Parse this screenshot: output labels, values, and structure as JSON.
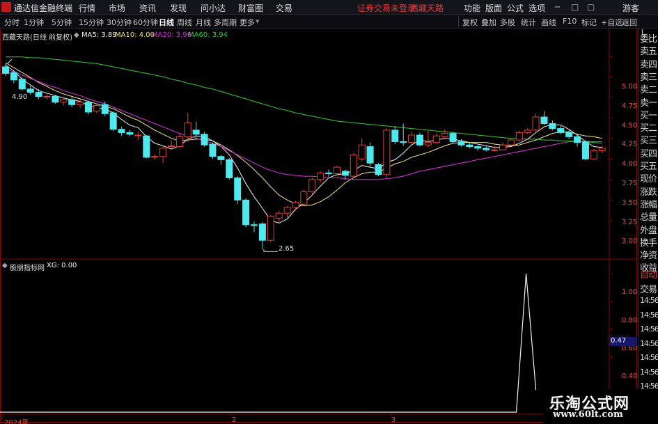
{
  "menubar": {
    "app_title": "通达信金融终端",
    "menus": [
      "行情",
      "市场",
      "资讯",
      "发现",
      "问小达",
      "财富圈",
      "交易"
    ],
    "trade_notice": "证券交易未登录",
    "stock_name": "西藏天路",
    "right_items": [
      "功能",
      "版面",
      "公式",
      "选项"
    ],
    "guest": "游客"
  },
  "toolbar": {
    "periods": [
      "分时",
      "1分钟",
      "5分钟",
      "15分钟",
      "30分钟",
      "60分钟",
      "日线",
      "周线",
      "月线",
      "多周期",
      "更多"
    ],
    "active_period": "日线",
    "tools": [
      "复权",
      "叠加",
      "多股",
      "统计",
      "画线",
      "F10",
      "标记",
      "+自选",
      "返回"
    ]
  },
  "main_panel": {
    "stock_label": "西藏天路(日线 前复权)",
    "ma_lines": [
      {
        "label": "MA5: 3.89",
        "color": "#f2f2f2"
      },
      {
        "label": "MA10: 4.00",
        "color": "#f0e68c"
      },
      {
        "label": "MA20: 3.96",
        "color": "#dd33dd"
      },
      {
        "label": "MA60: 3.94",
        "color": "#33cc33"
      }
    ],
    "y_labels": [
      "5.00",
      "4.75",
      "4.50",
      "4.25",
      "4.00",
      "3.75",
      "3.50",
      "3.25",
      "3.00"
    ],
    "y_range": [
      2.55,
      5.2
    ],
    "high_label": "4.90",
    "low_label": "2.65",
    "up_color": "#e0443a",
    "down_color": "#4ee8ee"
  },
  "candles": [
    [
      4.87,
      4.79,
      4.91,
      4.76
    ],
    [
      4.8,
      4.71,
      4.82,
      4.67
    ],
    [
      4.72,
      4.6,
      4.74,
      4.58
    ],
    [
      4.6,
      4.56,
      4.64,
      4.53
    ],
    [
      4.56,
      4.51,
      4.6,
      4.48
    ],
    [
      4.51,
      4.51,
      4.55,
      4.47
    ],
    [
      4.51,
      4.44,
      4.53,
      4.42
    ],
    [
      4.44,
      4.47,
      4.5,
      4.4
    ],
    [
      4.47,
      4.41,
      4.5,
      4.38
    ],
    [
      4.41,
      4.44,
      4.48,
      4.37
    ],
    [
      4.44,
      4.32,
      4.46,
      4.29
    ],
    [
      4.33,
      4.4,
      4.42,
      4.3
    ],
    [
      4.41,
      4.3,
      4.45,
      4.27
    ],
    [
      4.31,
      4.11,
      4.33,
      4.09
    ],
    [
      4.11,
      4.07,
      4.14,
      4.03
    ],
    [
      4.07,
      4.05,
      4.1,
      4.03
    ],
    [
      4.04,
      4.04,
      4.08,
      3.98
    ],
    [
      4.03,
      3.77,
      4.04,
      3.76
    ],
    [
      3.78,
      3.78,
      3.81,
      3.74
    ],
    [
      3.78,
      3.88,
      3.9,
      3.7
    ],
    [
      3.9,
      3.91,
      3.98,
      3.86
    ],
    [
      3.9,
      4.02,
      4.06,
      3.88
    ],
    [
      4.02,
      4.19,
      4.31,
      3.96
    ],
    [
      4.1,
      4.05,
      4.2,
      4.0
    ],
    [
      4.05,
      3.92,
      4.08,
      3.9
    ],
    [
      3.93,
      3.78,
      3.95,
      3.75
    ],
    [
      3.78,
      3.74,
      3.8,
      3.68
    ],
    [
      3.74,
      3.52,
      3.76,
      3.5
    ],
    [
      3.52,
      3.25,
      3.54,
      3.2
    ],
    [
      3.25,
      2.95,
      3.27,
      2.92
    ],
    [
      2.95,
      2.94,
      2.99,
      2.86
    ],
    [
      2.96,
      2.76,
      2.98,
      2.65
    ],
    [
      2.76,
      3.05,
      3.07,
      2.74
    ],
    [
      3.03,
      3.09,
      3.12,
      2.98
    ],
    [
      3.09,
      3.16,
      3.18,
      3.04
    ],
    [
      3.16,
      3.22,
      3.24,
      3.12
    ],
    [
      3.2,
      3.35,
      3.38,
      3.18
    ],
    [
      3.35,
      3.5,
      3.52,
      3.32
    ],
    [
      3.5,
      3.58,
      3.6,
      3.46
    ],
    [
      3.58,
      3.57,
      3.62,
      3.53
    ],
    [
      3.57,
      3.65,
      3.67,
      3.54
    ],
    [
      3.6,
      3.55,
      3.62,
      3.5
    ],
    [
      3.54,
      3.8,
      3.82,
      3.52
    ],
    [
      3.75,
      3.92,
      4.0,
      3.72
    ],
    [
      3.9,
      3.7,
      3.95,
      3.66
    ],
    [
      3.68,
      3.56,
      3.7,
      3.54
    ],
    [
      3.56,
      4.1,
      4.12,
      3.52
    ],
    [
      4.1,
      3.96,
      4.15,
      3.93
    ],
    [
      3.96,
      3.95,
      4.18,
      3.91
    ],
    [
      3.95,
      4.04,
      4.08,
      3.92
    ],
    [
      4.04,
      3.92,
      4.07,
      3.9
    ],
    [
      3.92,
      3.95,
      4.1,
      3.89
    ],
    [
      3.95,
      4.03,
      4.06,
      3.93
    ],
    [
      4.02,
      4.06,
      4.11,
      4.0
    ],
    [
      4.06,
      3.96,
      4.08,
      3.94
    ],
    [
      3.96,
      3.92,
      3.99,
      3.9
    ],
    [
      3.92,
      3.9,
      3.95,
      3.88
    ],
    [
      3.9,
      3.88,
      3.92,
      3.85
    ],
    [
      3.88,
      3.86,
      3.91,
      3.84
    ],
    [
      3.86,
      3.86,
      3.91,
      3.84
    ],
    [
      3.86,
      3.92,
      3.95,
      3.85
    ],
    [
      3.92,
      3.98,
      4.0,
      3.91
    ],
    [
      3.98,
      4.07,
      4.09,
      3.96
    ],
    [
      4.07,
      4.1,
      4.13,
      4.05
    ],
    [
      4.1,
      4.26,
      4.3,
      4.08
    ],
    [
      4.26,
      4.18,
      4.33,
      4.16
    ],
    [
      4.18,
      4.12,
      4.22,
      4.1
    ],
    [
      4.12,
      4.07,
      4.15,
      4.05
    ],
    [
      4.07,
      4.02,
      4.1,
      3.99
    ],
    [
      4.02,
      3.95,
      4.06,
      3.9
    ],
    [
      3.96,
      3.75,
      3.98,
      3.73
    ],
    [
      3.75,
      3.85,
      3.87,
      3.74
    ],
    [
      3.85,
      3.88,
      3.91,
      3.82
    ]
  ],
  "ma_series": {
    "ma5": [
      4.89,
      4.82,
      4.72,
      4.65,
      4.58,
      4.55,
      4.52,
      4.49,
      4.47,
      4.45,
      4.4,
      4.37,
      4.36,
      4.31,
      4.23,
      4.16,
      4.13,
      4.02,
      3.94,
      3.91,
      3.87,
      3.91,
      3.99,
      4.03,
      4.02,
      3.97,
      3.9,
      3.8,
      3.64,
      3.45,
      3.29,
      3.15,
      3.0,
      2.97,
      3.02,
      3.14,
      3.21,
      3.31,
      3.42,
      3.52,
      3.56,
      3.57,
      3.61,
      3.67,
      3.65,
      3.63,
      3.71,
      3.74,
      3.82,
      3.92,
      3.98,
      3.96,
      3.98,
      4.0,
      3.99,
      3.97,
      3.95,
      3.93,
      3.91,
      3.89,
      3.89,
      3.9,
      3.94,
      3.99,
      4.07,
      4.14,
      4.17,
      4.16,
      4.11,
      4.04,
      3.96,
      3.9,
      3.89
    ],
    "ma10": [
      4.92,
      4.86,
      4.8,
      4.74,
      4.68,
      4.63,
      4.58,
      4.54,
      4.51,
      4.48,
      4.45,
      4.42,
      4.39,
      4.36,
      4.31,
      4.26,
      4.22,
      4.16,
      4.1,
      4.05,
      4.0,
      3.97,
      3.98,
      3.99,
      3.99,
      3.97,
      3.92,
      3.86,
      3.79,
      3.71,
      3.62,
      3.52,
      3.41,
      3.31,
      3.25,
      3.2,
      3.18,
      3.19,
      3.23,
      3.29,
      3.37,
      3.46,
      3.52,
      3.57,
      3.59,
      3.59,
      3.64,
      3.69,
      3.72,
      3.77,
      3.8,
      3.83,
      3.87,
      3.91,
      3.94,
      3.95,
      3.95,
      3.95,
      3.95,
      3.93,
      3.92,
      3.91,
      3.92,
      3.95,
      3.98,
      4.02,
      4.06,
      4.08,
      4.08,
      4.05,
      4.03,
      4.02,
      4.0
    ],
    "ma20": [
      4.84,
      4.81,
      4.77,
      4.73,
      4.69,
      4.65,
      4.62,
      4.58,
      4.55,
      4.52,
      4.48,
      4.45,
      4.42,
      4.38,
      4.34,
      4.3,
      4.26,
      4.22,
      4.18,
      4.14,
      4.1,
      4.06,
      4.03,
      4.0,
      3.97,
      3.94,
      3.9,
      3.85,
      3.8,
      3.75,
      3.7,
      3.65,
      3.61,
      3.58,
      3.56,
      3.55,
      3.54,
      3.54,
      3.53,
      3.52,
      3.52,
      3.51,
      3.5,
      3.5,
      3.5,
      3.5,
      3.51,
      3.52,
      3.54,
      3.57,
      3.6,
      3.62,
      3.64,
      3.66,
      3.68,
      3.7,
      3.72,
      3.74,
      3.76,
      3.78,
      3.8,
      3.82,
      3.84,
      3.86,
      3.88,
      3.9,
      3.92,
      3.94,
      3.96,
      3.96,
      3.96,
      3.96,
      3.96
    ],
    "ma60": [
      4.99,
      4.99,
      4.99,
      4.98,
      4.98,
      4.97,
      4.96,
      4.95,
      4.94,
      4.93,
      4.92,
      4.91,
      4.89,
      4.87,
      4.85,
      4.83,
      4.81,
      4.79,
      4.77,
      4.75,
      4.72,
      4.7,
      4.67,
      4.65,
      4.62,
      4.6,
      4.57,
      4.54,
      4.51,
      4.48,
      4.45,
      4.42,
      4.39,
      4.36,
      4.34,
      4.31,
      4.29,
      4.27,
      4.25,
      4.23,
      4.21,
      4.2,
      4.19,
      4.18,
      4.17,
      4.16,
      4.15,
      4.14,
      4.13,
      4.12,
      4.11,
      4.1,
      4.09,
      4.08,
      4.07,
      4.06,
      4.05,
      4.04,
      4.03,
      4.02,
      4.01,
      4.0,
      4.0,
      3.99,
      3.99,
      3.98,
      3.98,
      3.97,
      3.97,
      3.96,
      3.96,
      3.95,
      3.94
    ]
  },
  "sub_panel": {
    "indicator_label": "股朋指标网",
    "xg_label": "XG: 0.00",
    "y_labels": [
      "1.00",
      "0.80",
      "0.60",
      "0.40"
    ],
    "current_value": "0.47",
    "values": [
      0,
      0,
      0,
      0,
      0,
      0,
      0,
      0,
      0,
      0,
      0,
      0,
      0,
      0,
      0,
      0,
      0,
      0,
      0,
      0,
      0,
      0,
      0,
      0,
      0,
      0,
      0,
      0,
      0,
      0,
      0,
      0,
      0,
      0,
      0,
      0,
      0,
      0,
      0,
      0,
      0,
      0,
      0,
      0,
      0,
      0,
      0,
      0,
      0,
      0,
      0,
      0,
      0,
      0,
      0,
      0,
      0,
      0,
      0,
      0,
      0,
      0,
      0,
      0,
      1,
      0,
      0,
      0,
      0,
      0,
      0,
      0,
      0
    ]
  },
  "x_axis": {
    "labels": [
      "2024年",
      "2",
      "3"
    ]
  },
  "right_panel": {
    "items": [
      "委比",
      "卖五",
      "卖四",
      "卖三",
      "卖二",
      "卖一",
      "买一",
      "买二",
      "买三",
      "买四",
      "买五",
      "现价",
      "涨跌",
      "涨幅",
      "总量",
      "外盘",
      "换手",
      "净资",
      "收益"
    ],
    "lower_items": [
      "自动",
      "交易",
      "14:56",
      "14:56",
      "14:56",
      "14:56",
      "14:56",
      "14:56",
      "14:56"
    ],
    "top_letter": "L"
  },
  "watermark": {
    "line1": "乐淘公式网",
    "line2": "www.60lt.com"
  },
  "chart_data": {
    "type": "candlestick",
    "title": "西藏天路(日线 前复权)",
    "y_range": [
      2.55,
      5.2
    ],
    "y_ticks": [
      "5.00",
      "4.75",
      "4.50",
      "4.25",
      "4.00",
      "3.75",
      "3.50",
      "3.25",
      "3.00"
    ],
    "x_labels": [
      "2024年",
      "2",
      "3"
    ],
    "annotations": [
      "4.90",
      "2.65"
    ],
    "series": [
      {
        "name": "MA5",
        "last": 3.89
      },
      {
        "name": "MA10",
        "last": 4.0
      },
      {
        "name": "MA20",
        "last": 3.96
      },
      {
        "name": "MA60",
        "last": 3.94
      },
      {
        "name": "XG",
        "last": 0.0
      }
    ]
  }
}
